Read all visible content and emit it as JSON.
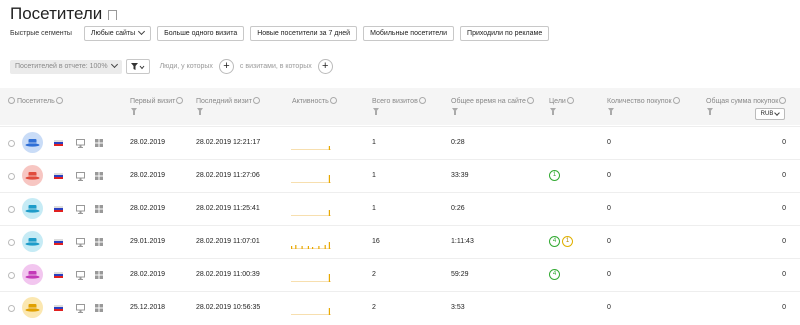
{
  "page": {
    "title": "Посетители"
  },
  "segments": {
    "label": "Быстрые сегменты",
    "buttons": [
      "Любые сайты",
      "Больше одного визита",
      "Новые посетители за 7 дней",
      "Мобильные посетители",
      "Приходили по рекламе"
    ]
  },
  "filter": {
    "sample": "Посетителей в отчете: 100%",
    "people_label": "Люди, у которых",
    "visits_label": "с визитами, в которых"
  },
  "columns": {
    "visitor": "Посетитель",
    "first_visit": "Первый визит",
    "last_visit": "Последний визит",
    "activity": "Активность",
    "total_visits": "Всего визитов",
    "total_time": "Общее время на сайте",
    "goals": "Цели",
    "purchases": "Количество покупок",
    "purchase_sum": "Общая сумма покупок",
    "currency": "RUB"
  },
  "rows": [
    {
      "avatar_bg": "#c9dcf7",
      "avatar_color": "#2f6fd6",
      "first": "28.02.2019",
      "last": "28.02.2019 12:21:17",
      "visits": "1",
      "time": "0:28",
      "goals": [],
      "purchases": "0",
      "sum": "0",
      "spark": [
        0,
        0,
        0,
        0,
        0,
        0,
        0,
        0,
        0,
        0,
        0,
        0,
        0,
        0,
        0,
        0,
        0,
        0,
        4
      ]
    },
    {
      "avatar_bg": "#f7c6c2",
      "avatar_color": "#e04b3c",
      "first": "28.02.2019",
      "last": "28.02.2019 11:27:06",
      "visits": "1",
      "time": "33:39",
      "goals": [
        {
          "n": "1",
          "c": "green"
        }
      ],
      "purchases": "0",
      "sum": "0",
      "spark": [
        0,
        0,
        0,
        0,
        0,
        0,
        0,
        0,
        0,
        0,
        0,
        0,
        0,
        0,
        0,
        0,
        0,
        0,
        8
      ]
    },
    {
      "avatar_bg": "#c6ebf5",
      "avatar_color": "#1e9cc9",
      "first": "28.02.2019",
      "last": "28.02.2019 11:25:41",
      "visits": "1",
      "time": "0:26",
      "goals": [],
      "purchases": "0",
      "sum": "0",
      "spark": [
        0,
        0,
        0,
        0,
        0,
        0,
        0,
        0,
        0,
        0,
        0,
        0,
        0,
        0,
        0,
        0,
        0,
        0,
        6
      ]
    },
    {
      "avatar_bg": "#c6ebf5",
      "avatar_color": "#1e9cc9",
      "first": "29.01.2019",
      "last": "28.02.2019 11:07:01",
      "visits": "16",
      "time": "1:11:43",
      "goals": [
        {
          "n": "4",
          "c": "green"
        },
        {
          "n": "1",
          "c": "yellow"
        }
      ],
      "purchases": "0",
      "sum": "0",
      "spark": [
        3,
        0,
        4,
        0,
        0,
        3,
        0,
        0,
        3,
        0,
        2,
        0,
        0,
        3,
        0,
        0,
        4,
        0,
        7
      ]
    },
    {
      "avatar_bg": "#f2c6ef",
      "avatar_color": "#c43ab8",
      "first": "28.02.2019",
      "last": "28.02.2019 11:00:39",
      "visits": "2",
      "time": "59:29",
      "goals": [
        {
          "n": "4",
          "c": "green"
        }
      ],
      "purchases": "0",
      "sum": "0",
      "spark": [
        0,
        0,
        0,
        0,
        0,
        0,
        0,
        0,
        0,
        0,
        0,
        0,
        0,
        0,
        0,
        0,
        0,
        0,
        8
      ]
    },
    {
      "avatar_bg": "#fbe7b0",
      "avatar_color": "#e0a000",
      "first": "25.12.2018",
      "last": "28.02.2019 10:56:35",
      "visits": "2",
      "time": "3:53",
      "goals": [],
      "purchases": "0",
      "sum": "0",
      "spark": [
        0,
        0,
        0,
        0,
        0,
        0,
        0,
        0,
        0,
        0,
        0,
        0,
        0,
        0,
        0,
        0,
        0,
        0,
        7
      ]
    }
  ]
}
